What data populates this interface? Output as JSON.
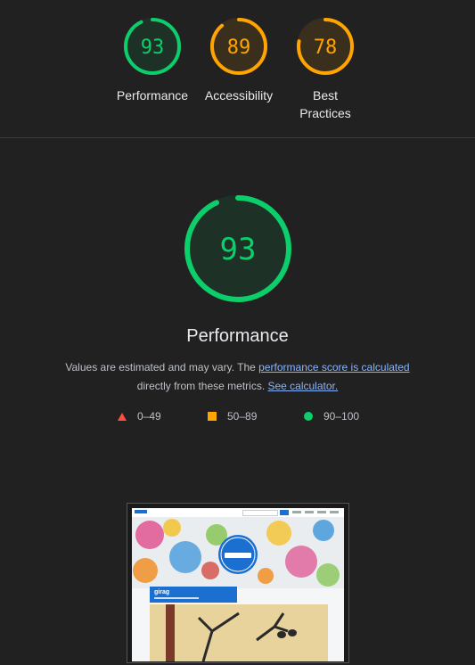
{
  "categories": [
    {
      "label_line1": "Performance",
      "label_line2": "",
      "score": "93",
      "value": 0.93,
      "color": "#0cce6b",
      "fill": "#1e3127"
    },
    {
      "label_line1": "Accessibility",
      "label_line2": "",
      "score": "89",
      "value": 0.89,
      "color": "#ffa400",
      "fill": "#3a2e1c"
    },
    {
      "label_line1": "Best",
      "label_line2": "Practices",
      "score": "78",
      "value": 0.78,
      "color": "#ffa400",
      "fill": "#3a2e1c"
    }
  ],
  "main": {
    "score": "93",
    "value": 0.93,
    "color": "#0cce6b",
    "title": "Performance",
    "desc_text1": "Values are estimated and may vary. The ",
    "desc_link1": "performance score is calculated",
    "desc_text2": " directly from these metrics. ",
    "desc_link2": "See calculator."
  },
  "legend": [
    {
      "icon": "triangle-icon",
      "range": "0–49",
      "color": "#ff4e42"
    },
    {
      "icon": "square-icon",
      "range": "50–89",
      "color": "#ffa400"
    },
    {
      "icon": "circle-icon",
      "range": "90–100",
      "color": "#0cce6b"
    }
  ],
  "screenshot": {
    "site_heading": "girag"
  }
}
